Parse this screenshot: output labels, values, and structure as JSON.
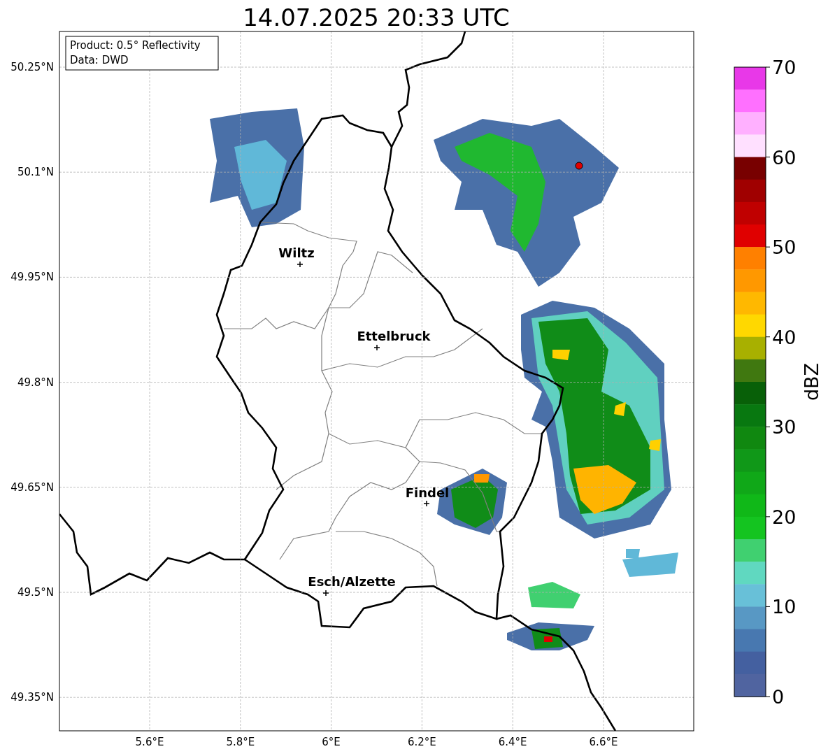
{
  "title": "14.07.2025 20:33 UTC",
  "info_box": [
    "Product: 0.5° Reflectivity",
    "Data: DWD"
  ],
  "map": {
    "latitude_ticks": [
      "50.25°N",
      "50.1°N",
      "49.95°N",
      "49.8°N",
      "49.65°N",
      "49.5°N",
      "49.35°N"
    ],
    "longitude_ticks": [
      "5.6°E",
      "5.8°E",
      "6°E",
      "6.2°E",
      "6.4°E",
      "6.6°E"
    ],
    "places": [
      {
        "name": "Wiltz"
      },
      {
        "name": "Ettelbruck"
      },
      {
        "name": "Findel"
      },
      {
        "name": "Esch/Alzette"
      }
    ]
  },
  "colorbar": {
    "label": "dBZ",
    "ticks": [
      "70",
      "60",
      "50",
      "40",
      "30",
      "20",
      "10",
      "0"
    ],
    "bands": [
      {
        "color": "#e838e8"
      },
      {
        "color": "#ff70ff"
      },
      {
        "color": "#ffb0ff"
      },
      {
        "color": "#ffe0ff"
      },
      {
        "color": "#780000"
      },
      {
        "color": "#a00000"
      },
      {
        "color": "#c00000"
      },
      {
        "color": "#e00000"
      },
      {
        "color": "#ff8000"
      },
      {
        "color": "#ff9800"
      },
      {
        "color": "#ffb800"
      },
      {
        "color": "#ffd800"
      },
      {
        "color": "#a8b000"
      },
      {
        "color": "#407810"
      },
      {
        "color": "#086008"
      },
      {
        "color": "#087810"
      },
      {
        "color": "#108810"
      },
      {
        "color": "#109818"
      },
      {
        "color": "#10a818"
      },
      {
        "color": "#10b818"
      },
      {
        "color": "#14c420"
      },
      {
        "color": "#40d070"
      },
      {
        "color": "#60d8c0"
      },
      {
        "color": "#68c0d8"
      },
      {
        "color": "#5898c4"
      },
      {
        "color": "#4878b0"
      },
      {
        "color": "#4460a0"
      },
      {
        "color": "#5064a0"
      }
    ]
  }
}
